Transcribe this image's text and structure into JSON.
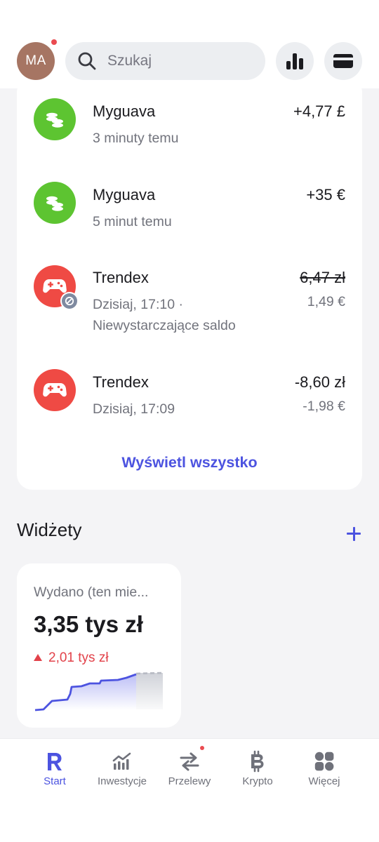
{
  "header": {
    "avatar_initials": "MA",
    "search_placeholder": "Szukaj",
    "icons": [
      "search-icon",
      "analytics-bars-icon",
      "card-icon"
    ]
  },
  "transactions": [
    {
      "name": "Myguava",
      "subtitle": "3 minuty temu",
      "amount": "+4,77 £",
      "secondary": "",
      "icon": "coins-icon",
      "color": "#5dc431",
      "struck": false,
      "declined": false
    },
    {
      "name": "Myguava",
      "subtitle": "5 minut temu",
      "amount": "+35 €",
      "secondary": "",
      "icon": "coins-icon",
      "color": "#5dc431",
      "struck": false,
      "declined": false
    },
    {
      "name": "Trendex",
      "subtitle": "Dzisiaj, 17:10 ·",
      "subtitle2": "Niewystarczające saldo",
      "amount": "6,47 zł",
      "secondary": "1,49 €",
      "icon": "gamepad-icon",
      "color": "#ef4a44",
      "struck": true,
      "declined": true
    },
    {
      "name": "Trendex",
      "subtitle": "Dzisiaj, 17:09",
      "amount": "-8,60 zł",
      "secondary": "-1,98 €",
      "icon": "gamepad-icon",
      "color": "#ef4a44",
      "struck": false,
      "declined": false
    }
  ],
  "view_all_label": "Wyświetl wszystko",
  "widgets": {
    "title": "Widżety",
    "spent_card": {
      "title": "Wydano (ten mie...",
      "value": "3,35 tys zł",
      "delta": "2,01 tys zł",
      "delta_direction": "up"
    }
  },
  "nav": [
    {
      "label": "Start",
      "icon": "revolut-r-icon",
      "active": true
    },
    {
      "label": "Inwestycje",
      "icon": "invest-chart-icon",
      "active": false
    },
    {
      "label": "Przelewy",
      "icon": "transfer-arrows-icon",
      "active": false,
      "dot": true
    },
    {
      "label": "Krypto",
      "icon": "bitcoin-icon",
      "active": false
    },
    {
      "label": "Więcej",
      "icon": "more-grid-icon",
      "active": false
    }
  ],
  "colors": {
    "accent": "#4c53e0",
    "positive_green": "#5dc431",
    "merchant_red": "#ef4a44",
    "delta_red": "#e2424a",
    "notification_dot": "#ea4b50"
  }
}
